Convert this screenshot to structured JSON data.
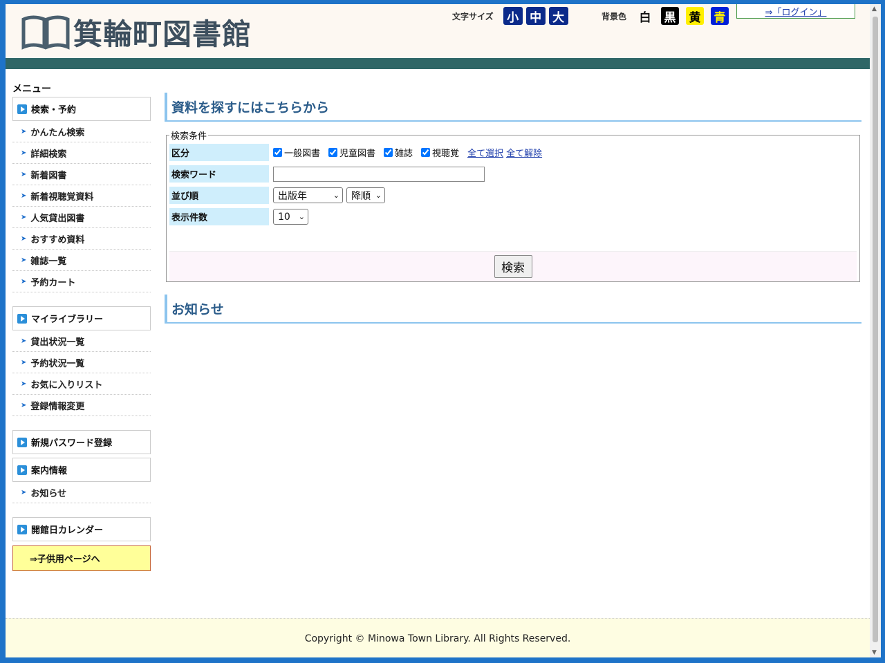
{
  "header": {
    "logo_text": "箕輪町図書館",
    "font_size_label": "文字サイズ",
    "font_sizes": [
      "小",
      "中",
      "大"
    ],
    "bg_label": "背景色",
    "bg_colors": [
      "白",
      "黒",
      "黄",
      "青"
    ],
    "login": "⇒「ログイン」"
  },
  "sidebar": {
    "menu_title": "メニュー",
    "search_section": "検索・予約",
    "search_items": [
      "かんたん検索",
      "詳細検索",
      "新着図書",
      "新着視聴覚資料",
      "人気貸出図書",
      "おすすめ資料",
      "雑誌一覧",
      "予約カート"
    ],
    "mylib_section": "マイライブラリー",
    "mylib_items": [
      "貸出状況一覧",
      "予約状況一覧",
      "お気に入りリスト",
      "登録情報変更"
    ],
    "password_section": "新規パスワード登録",
    "info_section": "案内情報",
    "info_items": [
      "お知らせ"
    ],
    "calendar_section": "開館日カレンダー",
    "kids_link": "⇒子供用ページへ"
  },
  "main": {
    "search_heading": "資料を探すにはこちらから",
    "legend": "検索条件",
    "category_label": "区分",
    "categories": [
      "一般図書",
      "児童図書",
      "雑誌",
      "視聴覚"
    ],
    "select_all": "全て選択",
    "deselect_all": "全て解除",
    "keyword_label": "検索ワード",
    "keyword_value": "",
    "sort_label": "並び順",
    "sort_field": "出版年",
    "sort_order": "降順",
    "count_label": "表示件数",
    "count_value": "10",
    "search_button": "検索",
    "news_heading": "お知らせ"
  },
  "footer": {
    "copyright": "Copyright © Minowa Town Library. All Rights Reserved."
  }
}
